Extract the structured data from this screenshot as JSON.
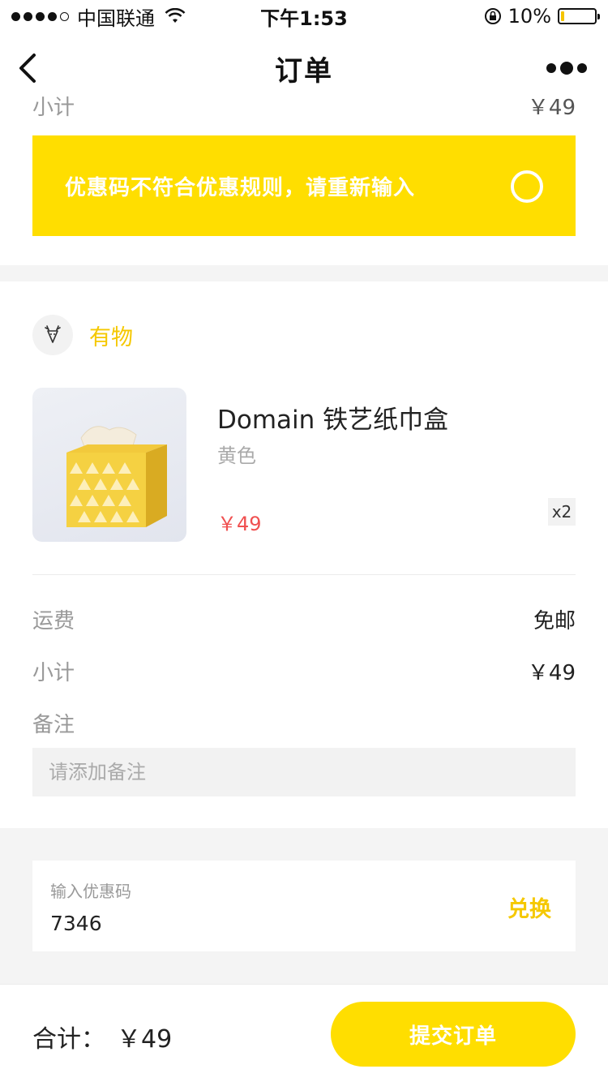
{
  "status_bar": {
    "carrier": "中国联通",
    "time": "下午1:53",
    "battery_text": "10%",
    "battery_level": 0.1
  },
  "nav": {
    "title": "订单"
  },
  "peek": {
    "label": "小计",
    "value": "￥49"
  },
  "toast": {
    "message": "优惠码不符合优惠规则，请重新输入"
  },
  "shop": {
    "name": "有物"
  },
  "product": {
    "title": "Domain 铁艺纸巾盒",
    "variant": "黄色",
    "price": "￥49",
    "quantity": "x2"
  },
  "summary": {
    "shipping_label": "运费",
    "shipping_value": "免邮",
    "subtotal_label": "小计",
    "subtotal_value": "￥49",
    "remark_label": "备注",
    "remark_placeholder": "请添加备注"
  },
  "coupon": {
    "label": "输入优惠码",
    "value": "7346",
    "redeem_label": "兑换"
  },
  "footer": {
    "total_label": "合计：",
    "total_value": "￥49",
    "submit_label": "提交订单"
  },
  "colors": {
    "accent": "#ffde00",
    "shop_accent": "#f5c800",
    "price": "#f05050"
  },
  "icons": {
    "back": "chevron-left-icon",
    "more": "more-dots-icon",
    "shop_logo": "deer-logo-icon",
    "toast_status": "circle-icon",
    "wifi": "wifi-icon",
    "lock": "rotation-lock-icon"
  }
}
